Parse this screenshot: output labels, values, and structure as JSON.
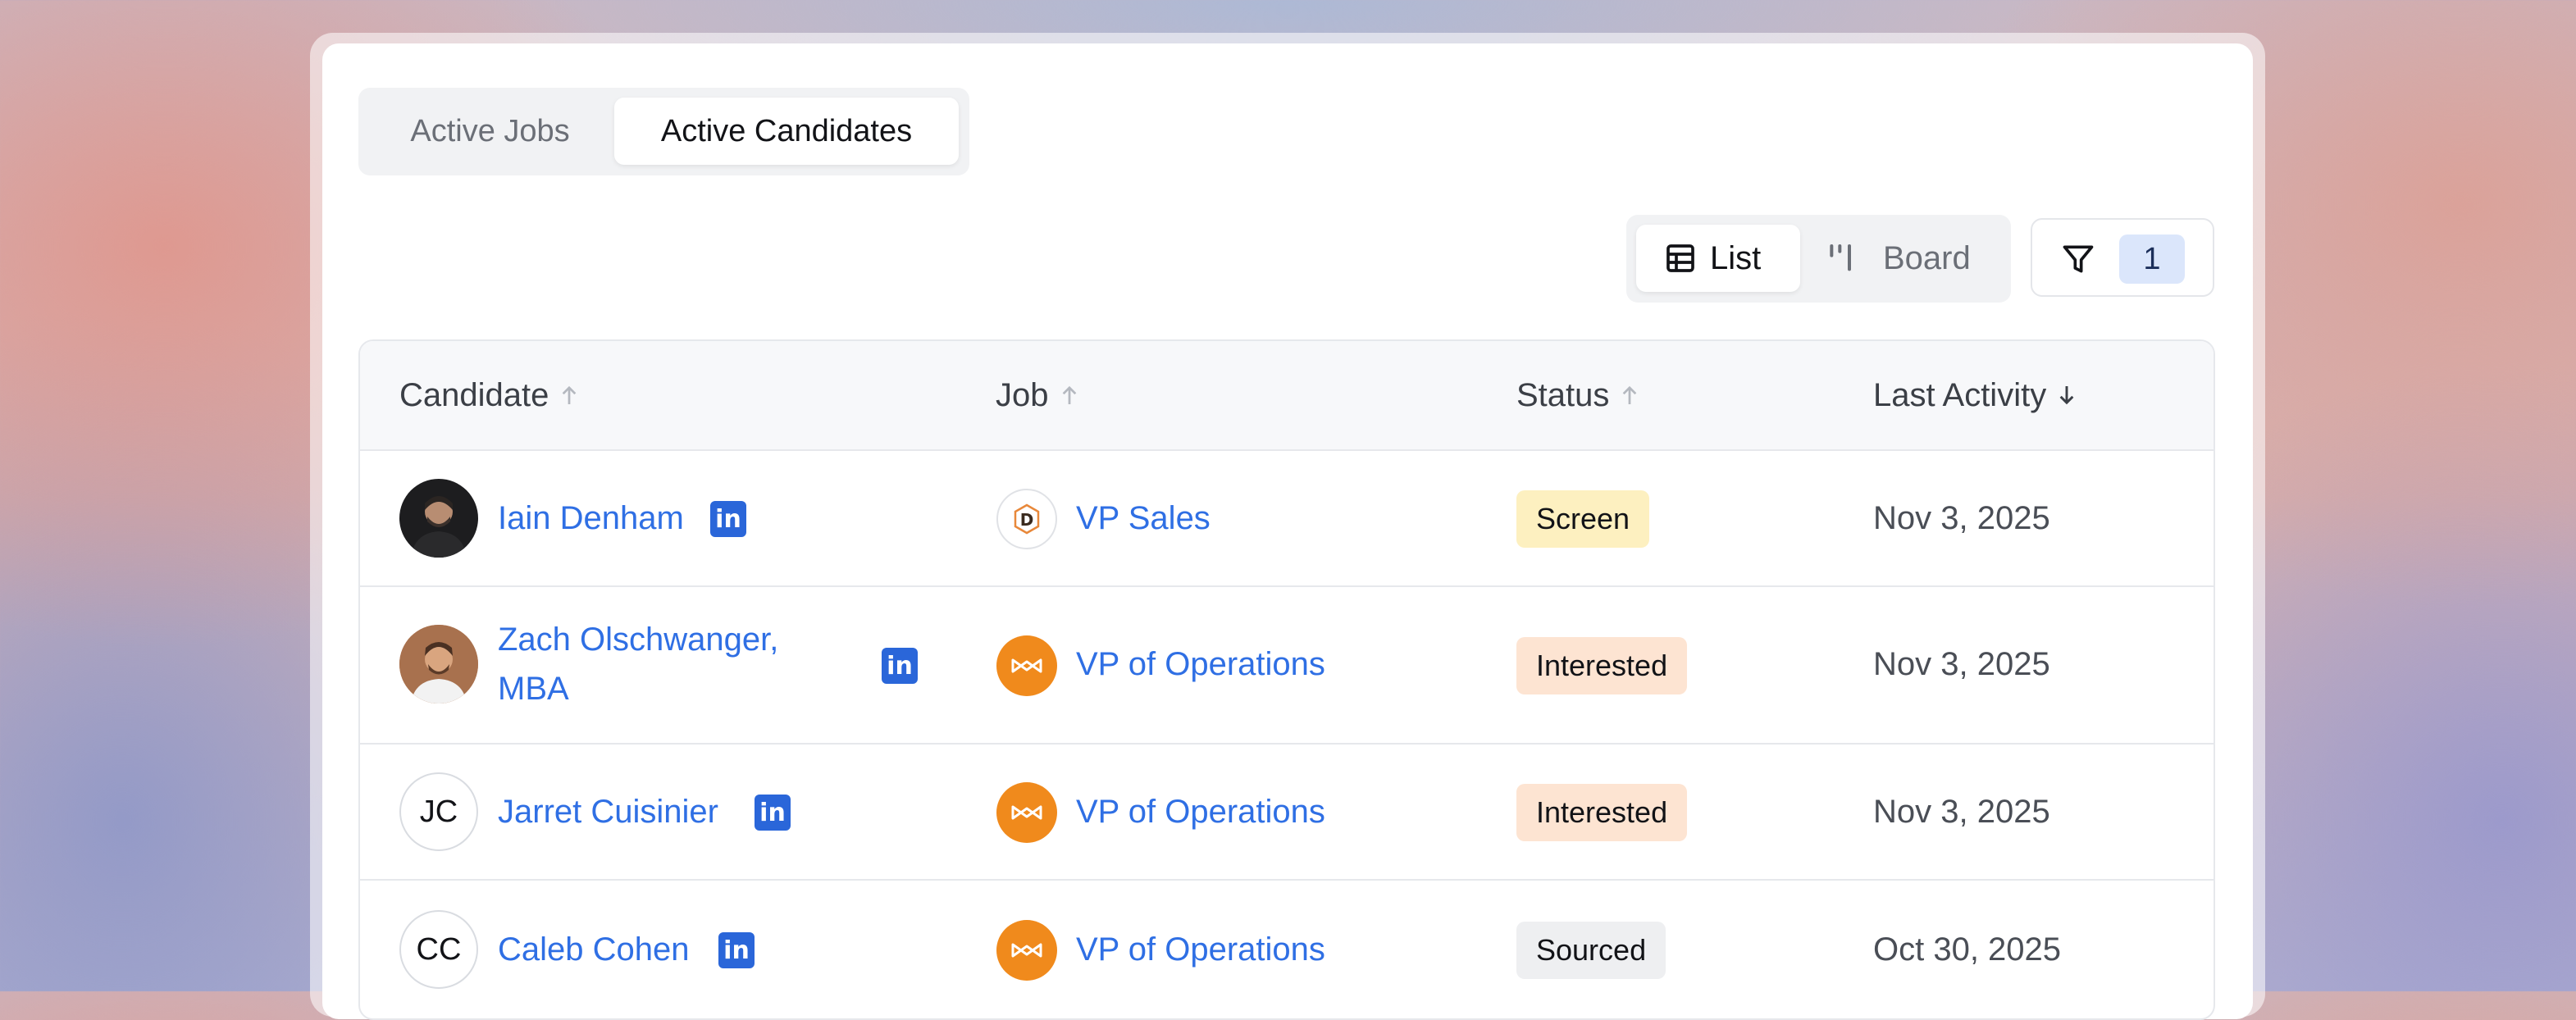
{
  "tabs": {
    "active_jobs": "Active Jobs",
    "active_candidates": "Active Candidates"
  },
  "view": {
    "list": "List",
    "board": "Board",
    "filter_count": "1"
  },
  "table": {
    "headers": {
      "candidate": "Candidate",
      "job": "Job",
      "status": "Status",
      "last_activity": "Last Activity"
    },
    "rows": [
      {
        "name": "Iain Denham",
        "initials": "",
        "job": "VP Sales",
        "status": "Screen",
        "status_color": "#fdf0c0",
        "date": "Nov 3, 2025"
      },
      {
        "name_line1": "Zach Olschwanger,",
        "name_line2": "MBA",
        "initials": "",
        "job": "VP of Operations",
        "status": "Interested",
        "status_color": "#fde4d2",
        "date": "Nov 3, 2025"
      },
      {
        "name": "Jarret Cuisinier",
        "initials": "JC",
        "job": "VP of Operations",
        "status": "Interested",
        "status_color": "#fde4d2",
        "date": "Nov 3, 2025"
      },
      {
        "name": "Caleb Cohen",
        "initials": "CC",
        "job": "VP of Operations",
        "status": "Sourced",
        "status_color": "#eeeff1",
        "date": "Oct 30, 2025"
      }
    ]
  },
  "colors": {
    "link": "#2f6fe4",
    "brand_orange": "#f08a1c",
    "linkedin": "#2a66d9"
  }
}
